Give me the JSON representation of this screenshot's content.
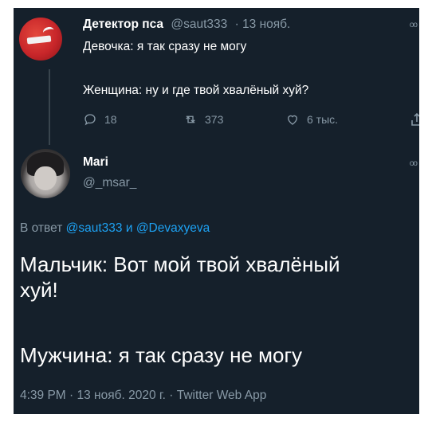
{
  "parent_tweet": {
    "name": "Детектор пса",
    "handle": "@saut333",
    "time": "· 13 нояб.",
    "line1": "Девочка: я так сразу не могу",
    "line2": "Женщина: ну и где твой хвалёный хуй?",
    "replies": "18",
    "retweets": "373",
    "likes": "6 тыс."
  },
  "reply_tweet": {
    "name": "Mari",
    "handle": "@_msar_",
    "reply_prefix": "В ответ",
    "reply_user1": "@saut333",
    "reply_and": "и",
    "reply_user2": "@Devaxyeva",
    "body_line1": "Мальчик: Вот мой твой хвалёный",
    "body_line2": "хуй!",
    "body_line3": "Мужчина: я так сразу не могу",
    "footer": "4:39 PM · 13 нояб. 2020 г. · Twitter Web App"
  },
  "icons": [
    "reply-icon",
    "retweet-icon",
    "like-icon",
    "share-icon"
  ],
  "colors": {
    "background": "#15202b",
    "text": "#ffffff",
    "secondary": "#8899a6",
    "link": "#1da1f2",
    "thread_line": "#38444d"
  }
}
